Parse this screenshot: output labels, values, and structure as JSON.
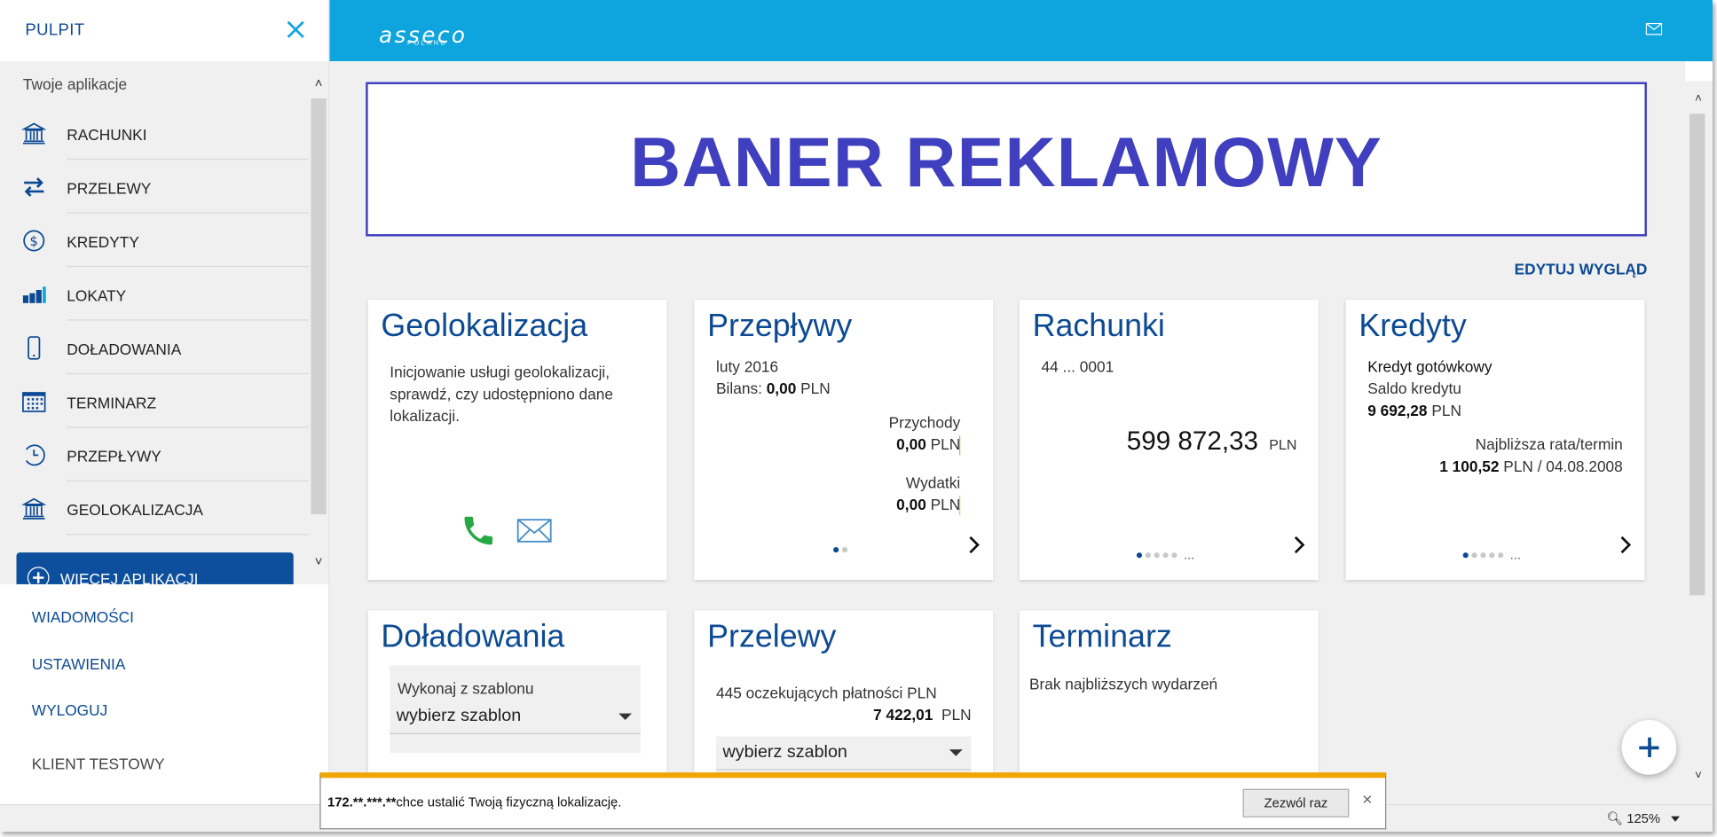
{
  "sidebar": {
    "title": "PULPIT",
    "apps_header": "Twoje aplikacje",
    "items": [
      {
        "label": "RACHUNKI",
        "icon": "bank-icon"
      },
      {
        "label": "PRZELEWY",
        "icon": "transfer-arrows-icon"
      },
      {
        "label": "KREDYTY",
        "icon": "dollar-icon"
      },
      {
        "label": "LOKATY",
        "icon": "coins-icon"
      },
      {
        "label": "DOŁADOWANIA",
        "icon": "mobile-phone-icon"
      },
      {
        "label": "TERMINARZ",
        "icon": "calendar-icon"
      },
      {
        "label": "PRZEPŁYWY",
        "icon": "clock-icon"
      },
      {
        "label": "GEOLOKALIZACJA",
        "icon": "bank-icon"
      }
    ],
    "more_button": "WIĘCEJ APLIKACJI",
    "links": [
      "WIADOMOŚCI",
      "USTAWIENIA",
      "WYLOGUJ"
    ],
    "user": "KLIENT TESTOWY"
  },
  "header": {
    "brand": "asseco",
    "brand_sub": "POLAND"
  },
  "banner": "BANER REKLAMOWY",
  "edit_link": "EDYTUJ WYGLĄD",
  "cards": {
    "geo": {
      "title": "Geolokalizacja",
      "text": "Inicjowanie usługi geolokalizacji, sprawdź, czy udostępniono dane lokalizacji."
    },
    "flows": {
      "title": "Przepływy",
      "period": "luty 2016",
      "balance_label": "Bilans:",
      "balance_value": "0,00",
      "currency": "PLN",
      "income_label": "Przychody",
      "income_value": "0,00",
      "expense_label": "Wydatki",
      "expense_value": "0,00"
    },
    "accounts": {
      "title": "Rachunki",
      "account": "44 ... 0001",
      "amount": "599 872,33",
      "currency": "PLN",
      "ellipsis": "..."
    },
    "credits": {
      "title": "Kredyty",
      "name": "Kredyt gotówkowy",
      "balance_label": "Saldo kredytu",
      "balance_value": "9 692,28",
      "currency": "PLN",
      "next_label": "Najbliższa rata/termin",
      "next_value": "1 100,52",
      "next_date": "PLN / 04.08.2008",
      "ellipsis": "..."
    },
    "topup": {
      "title": "Doładowania",
      "template_label": "Wykonaj z szablonu",
      "template_select": "wybierz szablon"
    },
    "transfers": {
      "title": "Przelewy",
      "pending": "445 oczekujących płatności PLN",
      "amount": "7 422,01",
      "currency": "PLN",
      "template_select": "wybierz szablon"
    },
    "calendar": {
      "title": "Terminarz",
      "text": "Brak najbliższych wydarzeń"
    }
  },
  "notification": {
    "host": "172.**.***.**",
    "message": "chce ustalić Twoją fizyczną lokalizację.",
    "allow": "Zezwól raz",
    "close": "×"
  },
  "statusbar": {
    "zoom": "125%"
  },
  "colors": {
    "accent": "#0c4a94",
    "header": "#0ea5de",
    "banner": "#3f3fbf",
    "phone": "#27a845"
  }
}
